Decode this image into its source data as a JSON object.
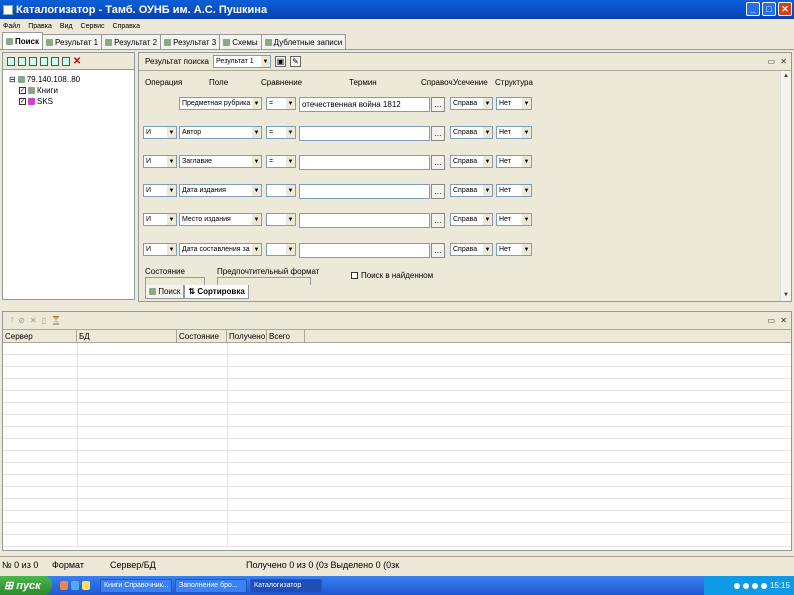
{
  "window": {
    "title": "Каталогизатор - Тамб. ОУНБ им. А.С. Пушкина"
  },
  "menu": [
    "Файл",
    "Правка",
    "Вид",
    "Сервис",
    "Справка"
  ],
  "tabs": [
    "Поиск",
    "Результат 1",
    "Результат 2",
    "Результат 3",
    "Схемы",
    "Дублетные записи"
  ],
  "tree": {
    "root": "79.140.108..80",
    "items": [
      "Книги",
      "SKS"
    ]
  },
  "search_panel": {
    "result_label": "Результат поиска",
    "result_value": "Результат 1",
    "headers": {
      "operation": "Операция",
      "field": "Поле",
      "compare": "Сравнение",
      "term": "Термин",
      "reference": "Справоч.",
      "truncation": "Усечение",
      "structure": "Структура"
    },
    "rows": [
      {
        "op": "",
        "field": "Предметная рубрика",
        "cmp": "=",
        "term": "отечественная война 1812",
        "trunc": "Справа",
        "struct": "Нет"
      },
      {
        "op": "И",
        "field": "Автор",
        "cmp": "=",
        "term": "",
        "trunc": "Справа",
        "struct": "Нет"
      },
      {
        "op": "И",
        "field": "Заглавие",
        "cmp": "=",
        "term": "",
        "trunc": "Справа",
        "struct": "Нет"
      },
      {
        "op": "И",
        "field": "Дата издания",
        "cmp": "",
        "term": "",
        "trunc": "Справа",
        "struct": "Нет"
      },
      {
        "op": "И",
        "field": "Место издания",
        "cmp": "",
        "term": "",
        "trunc": "Справа",
        "struct": "Нет"
      },
      {
        "op": "И",
        "field": "Дата составления за",
        "cmp": "",
        "term": "",
        "trunc": "Справа",
        "struct": "Нет"
      }
    ],
    "state_label": "Состояние",
    "format_label": "Предпочтительный формат",
    "search_found_label": "Поиск в найденном",
    "bottom_tabs": [
      "Поиск",
      "Сортировка"
    ]
  },
  "grid": {
    "columns": [
      "Сервер",
      "БД",
      "Состояние",
      "Получено",
      "Всего"
    ]
  },
  "status": {
    "records": "№ 0 из 0",
    "format": "Формат",
    "server": "Сервер/БД",
    "received": "Получено 0 из 0 (0з Выделено 0 (0зк"
  },
  "taskbar": {
    "start": "пуск",
    "tasks": [
      "Книги Справочник...",
      "Заполнение бро...",
      "Каталогизатор"
    ],
    "clock": "15:15"
  },
  "colors": {
    "title_bar": "#0842b0",
    "start_button": "#2b8a2b",
    "taskbar": "#1f57d2"
  }
}
